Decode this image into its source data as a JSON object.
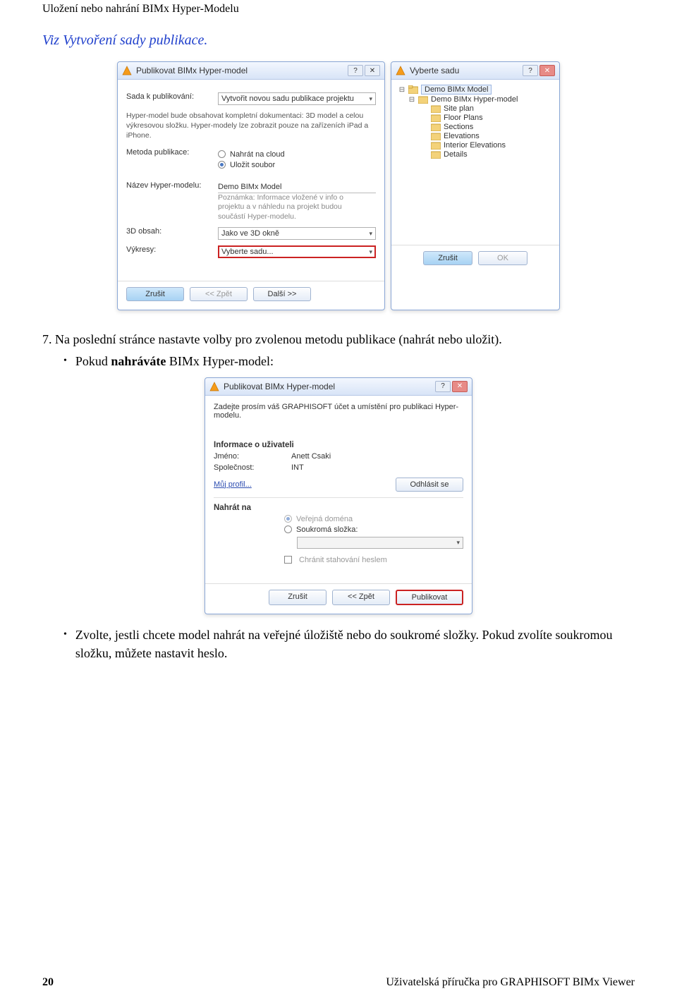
{
  "header": {
    "title": "Uložení nebo nahrání BIMx Hyper-Modelu"
  },
  "intro_link": {
    "prefix": "Viz ",
    "text": "Vytvoření sady publikace."
  },
  "dialog1": {
    "title": "Publikovat BIMx Hyper-model",
    "help_glyph": "?",
    "close_glyph": "✕",
    "rows": {
      "set_label": "Sada k publikování:",
      "set_value": "Vytvořit novou sadu publikace projektu",
      "desc": "Hyper-model bude obsahovat kompletní dokumentaci: 3D model a celou výkresovou složku. Hyper-modely lze zobrazit pouze na zařízeních iPad a iPhone.",
      "method_label": "Metoda publikace:",
      "method_opt1": "Nahrát na cloud",
      "method_opt2": "Uložit soubor",
      "name_label": "Název Hyper-modelu:",
      "name_value": "Demo BIMx Model",
      "name_note": "Poznámka: Informace vložené v info o projektu a v náhledu na projekt budou součástí Hyper-modelu.",
      "content3d_label": "3D obsah:",
      "content3d_value": "Jako ve 3D okně",
      "drawings_label": "Výkresy:",
      "drawings_value": "Vyberte sadu..."
    },
    "buttons": {
      "cancel": "Zrušit",
      "back": "<< Zpět",
      "next": "Další >>"
    }
  },
  "dialog2": {
    "title": "Vyberte sadu",
    "help_glyph": "?",
    "close_glyph": "✕",
    "tree": {
      "root": "Demo BIMx Model",
      "items": [
        "Demo BIMx Hyper-model",
        "Site plan",
        "Floor Plans",
        "Sections",
        "Elevations",
        "Interior Elevations",
        "Details"
      ]
    },
    "buttons": {
      "cancel": "Zrušit",
      "ok": "OK"
    }
  },
  "step7": {
    "text": "7. Na poslední stránce nastavte volby pro zvolenou metodu publikace (nahrát nebo uložit).",
    "bullet_prefix": "Pokud ",
    "bullet_bold": "nahráváte",
    "bullet_rest": " BIMx Hyper-model:"
  },
  "dialog3": {
    "title": "Publikovat BIMx Hyper-model",
    "help_glyph": "?",
    "close_glyph": "✕",
    "intro": "Zadejte prosím váš GRAPHISOFT účet a umístění pro publikaci Hyper-modelu.",
    "user_heading": "Informace o uživateli",
    "name_label": "Jméno:",
    "name_value": "Anett Csaki",
    "company_label": "Společnost:",
    "company_value": "INT",
    "profile_link": "Můj profil...",
    "logout": "Odhlásit se",
    "upload_heading": "Nahrát na",
    "upload_opt1": "Veřejná doména",
    "upload_opt2": "Soukromá složka:",
    "protect_label": "Chránit stahování heslem",
    "buttons": {
      "cancel": "Zrušit",
      "back": "<< Zpět",
      "publish": "Publikovat"
    }
  },
  "bullet2": "Zvolte, jestli chcete model nahrát na veřejné úložiště nebo do soukromé složky. Pokud zvolíte soukromou složku, můžete nastavit heslo.",
  "footer": {
    "page": "20",
    "doc": "Uživatelská příručka pro GRAPHISOFT BIMx Viewer"
  }
}
